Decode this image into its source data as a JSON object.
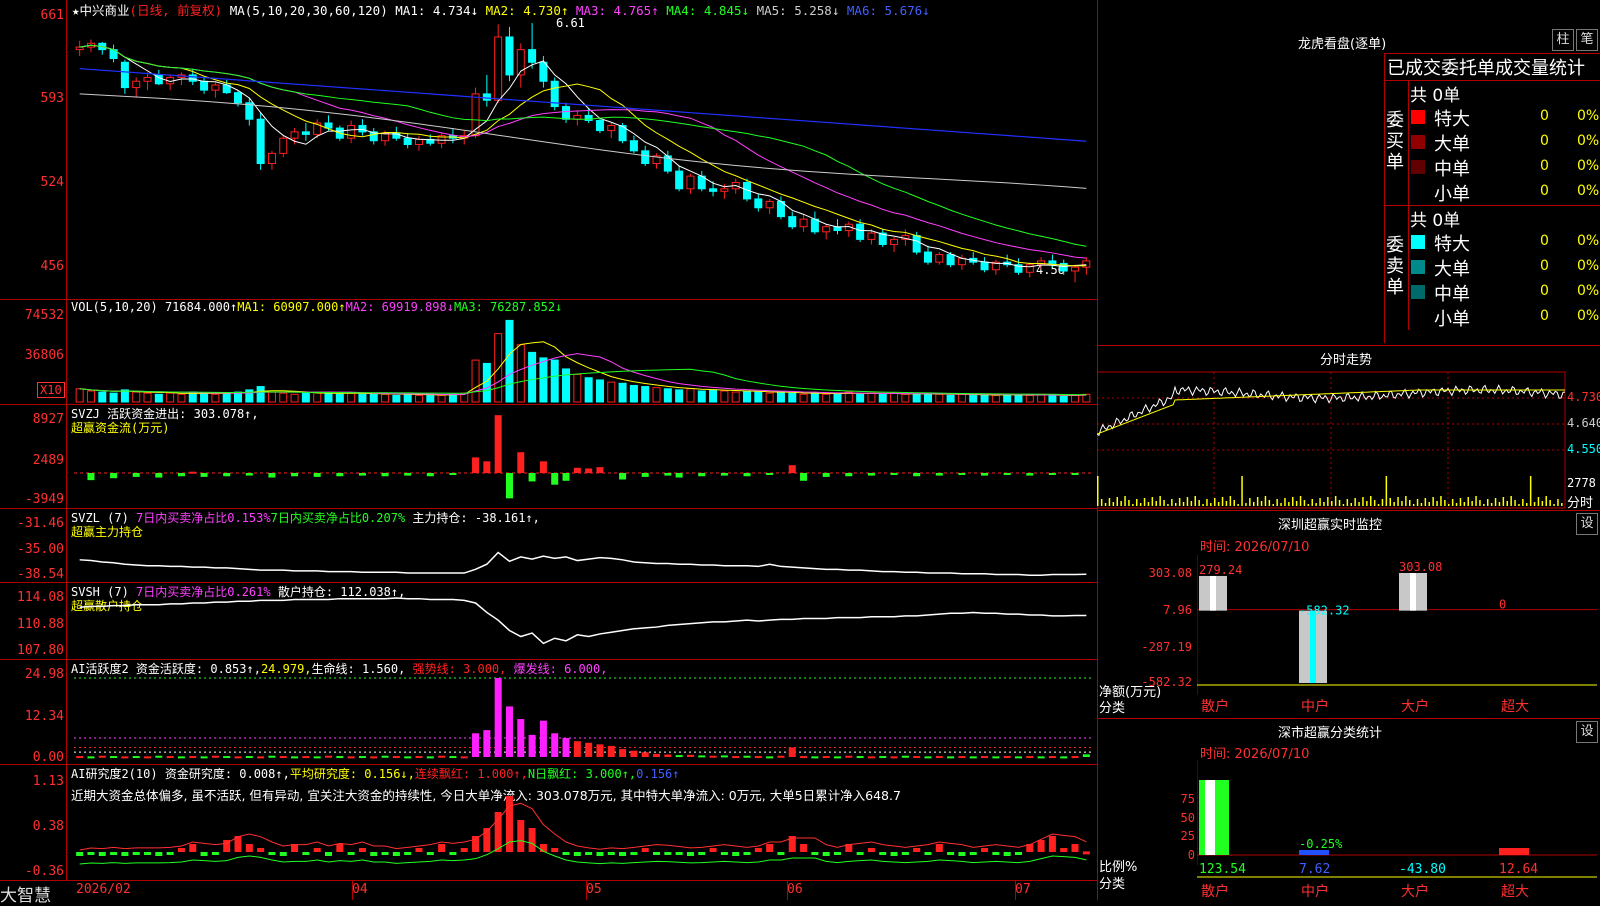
{
  "colors": {
    "up": "#ff2020",
    "down": "#00ffff",
    "bg": "#000000",
    "ma1": "#ffffff",
    "ma2": "#ffff00",
    "ma3": "#ff40ff",
    "ma4": "#20ff20",
    "ma5": "#cccccc",
    "ma6": "#2030ff"
  },
  "main": {
    "star": "★",
    "name": "中兴商业",
    "mode": "(日线, 前复权)",
    "ma_title": "MA(5,10,20,30,60,120)",
    "ma1": "MA1: 4.734↓",
    "ma2": "MA2: 4.730↑",
    "ma3": "MA3: 4.765↑",
    "ma4": "MA4: 4.845↓",
    "ma5": "MA5: 5.258↓",
    "ma6": "MA6: 5.676↓",
    "high_mark": "6.61",
    "low_mark": "4.56",
    "y_ticks": [
      "661",
      "593",
      "524",
      "456"
    ]
  },
  "vol": {
    "title": "VOL(5,10,20)",
    "value": "71684.000↑",
    "ma1": "MA1: 60907.000↑",
    "ma2": "MA2: 69919.898↓",
    "ma3": "MA3: 76287.852↓",
    "y_ticks": [
      "74532",
      "36806"
    ],
    "unit": "X10"
  },
  "svzj": {
    "title": "SVZJ",
    "label": "活跃资金进出: 303.078↑,",
    "sub": "超赢资金流(万元)",
    "y_ticks": [
      "8927",
      "2489",
      "-3949"
    ]
  },
  "svzl": {
    "title": "SVZL (7)",
    "a": "7日内买卖净占比0.153%",
    "b": "7日内买卖净占比0.207%",
    "c": "主力持仓: -38.161↑,",
    "sub": "超赢主力持仓",
    "y_ticks": [
      "-31.46",
      "-35.00",
      "-38.54"
    ]
  },
  "svsh": {
    "title": "SVSH (7)",
    "a": "7日内买卖净占比0.261%",
    "c": "散户持仓: 112.038↑,",
    "sub": "超赢散户持仓",
    "y_ticks": [
      "114.08",
      "110.88",
      "107.80"
    ]
  },
  "ai1": {
    "title": "AI活跃度2",
    "a": "资金活跃度: 0.853↑,",
    "b": "24.979,",
    "c": "生命线: 1.560,",
    "d": "强势线: 3.000,",
    "e": "爆发线: 6.000,",
    "y_ticks": [
      "24.98",
      "12.34",
      "0.00"
    ]
  },
  "ai2": {
    "title": "AI研究度2(10)",
    "a": "资金研究度: 0.008↑,",
    "b": "平均研究度: 0.156↓,",
    "c": "连续飘红: 1.000↑,",
    "d": "N日飘红: 3.000↑,",
    "e": "0.156↑",
    "comment": "近期大资金总体偏多, 虽不活跃, 但有异动, 宜关注大资金的持续性, 今日大单净流入: 303.078万元, 其中特大单净流入: 0万元, 大单5日累计净入648.7",
    "y_ticks": [
      "1.13",
      "0.38",
      "-0.36"
    ]
  },
  "xaxis": {
    "labels": [
      "2026/02",
      "04",
      "05",
      "06",
      "07"
    ],
    "brand": "大智慧"
  },
  "right": {
    "lhk_title": "龙虎看盘(逐单)",
    "btn1": "柱",
    "btn2": "笔",
    "stat_title": "已成交委托单成交量统计",
    "buy_label": "委买单",
    "sell_label": "委卖单",
    "buy_total": "共 0单",
    "sell_total": "共 0单",
    "buy_rows": [
      {
        "name": "特大",
        "count": "0",
        "pct": "0%",
        "color": "#ff0000"
      },
      {
        "name": "大单",
        "count": "0",
        "pct": "0%",
        "color": "#900000"
      },
      {
        "name": "中单",
        "count": "0",
        "pct": "0%",
        "color": "#600000"
      },
      {
        "name": "小单",
        "count": "0",
        "pct": "0%",
        "color": "#000000"
      }
    ],
    "sell_rows": [
      {
        "name": "特大",
        "count": "0",
        "pct": "0%",
        "color": "#00ffff"
      },
      {
        "name": "大单",
        "count": "0",
        "pct": "0%",
        "color": "#008a8a"
      },
      {
        "name": "中单",
        "count": "0",
        "pct": "0%",
        "color": "#006a6a"
      },
      {
        "name": "小单",
        "count": "0",
        "pct": "0%",
        "color": "#000000"
      }
    ],
    "intraday_title": "分时走势",
    "intraday_ticks": [
      "4.730",
      "4.640",
      "4.550"
    ],
    "intraday_vol": "2778",
    "intraday_vol_unit": "分时",
    "sz_title": "深圳超赢实时监控",
    "sz_btn": "设",
    "sz_time": "时间: 2026/07/10",
    "sz_ticks": [
      "303.08",
      "7.96",
      "-287.19",
      "-582.32"
    ],
    "sz_axis1": "净额(万元)",
    "sz_axis2": "分类",
    "sz_values": [
      {
        "label": "279.24",
        "v": 279.24
      },
      {
        "label": "-582.32",
        "v": -582.32
      },
      {
        "label": "303.08",
        "v": 303.08
      },
      {
        "label": "0",
        "v": 0
      }
    ],
    "sz_cats": [
      "散户",
      "中户",
      "大户",
      "超大"
    ],
    "cls_title": "深市超赢分类统计",
    "cls_btn": "设",
    "cls_time": "时间: 2026/07/10",
    "cls_ticks": [
      "75",
      "50",
      "25",
      "0"
    ],
    "cls_axis1": "比例%",
    "cls_axis2": "分类",
    "cls_values": [
      "123.54",
      "7.62",
      "-43.80",
      "12.64"
    ],
    "cls_mid": "-0.25%",
    "cls_cats": [
      "散户",
      "中户",
      "大户",
      "超大"
    ]
  },
  "chart_data": {
    "type": "candlestick",
    "title": "中兴商业",
    "xlabel": "",
    "ylabel": "",
    "x_labels": [
      "2026/02",
      "04",
      "05",
      "06",
      "07"
    ],
    "ylim": [
      4.5,
      6.65
    ],
    "ohlc": [
      [
        6.4,
        6.47,
        6.35,
        6.42
      ],
      [
        6.42,
        6.48,
        6.38,
        6.45
      ],
      [
        6.45,
        6.46,
        6.36,
        6.4
      ],
      [
        6.4,
        6.44,
        6.3,
        6.33
      ],
      [
        6.3,
        6.32,
        6.05,
        6.1
      ],
      [
        6.1,
        6.18,
        6.02,
        6.15
      ],
      [
        6.15,
        6.22,
        6.08,
        6.18
      ],
      [
        6.2,
        6.24,
        6.12,
        6.13
      ],
      [
        6.13,
        6.2,
        6.08,
        6.18
      ],
      [
        6.18,
        6.22,
        6.12,
        6.2
      ],
      [
        6.2,
        6.25,
        6.12,
        6.15
      ],
      [
        6.15,
        6.19,
        6.05,
        6.08
      ],
      [
        6.08,
        6.14,
        6.02,
        6.12
      ],
      [
        6.12,
        6.16,
        6.05,
        6.06
      ],
      [
        6.06,
        6.08,
        5.95,
        5.98
      ],
      [
        5.98,
        6.02,
        5.8,
        5.85
      ],
      [
        5.85,
        5.9,
        5.45,
        5.5
      ],
      [
        5.5,
        5.6,
        5.45,
        5.58
      ],
      [
        5.58,
        5.72,
        5.55,
        5.7
      ],
      [
        5.7,
        5.78,
        5.65,
        5.75
      ],
      [
        5.75,
        5.82,
        5.68,
        5.73
      ],
      [
        5.73,
        5.85,
        5.7,
        5.82
      ],
      [
        5.82,
        5.88,
        5.76,
        5.78
      ],
      [
        5.78,
        5.8,
        5.68,
        5.7
      ],
      [
        5.7,
        5.84,
        5.66,
        5.8
      ],
      [
        5.8,
        5.85,
        5.72,
        5.75
      ],
      [
        5.75,
        5.78,
        5.65,
        5.68
      ],
      [
        5.68,
        5.76,
        5.64,
        5.74
      ],
      [
        5.74,
        5.79,
        5.68,
        5.7
      ],
      [
        5.7,
        5.74,
        5.62,
        5.65
      ],
      [
        5.65,
        5.72,
        5.6,
        5.69
      ],
      [
        5.69,
        5.73,
        5.64,
        5.66
      ],
      [
        5.66,
        5.74,
        5.62,
        5.72
      ],
      [
        5.72,
        5.78,
        5.66,
        5.7
      ],
      [
        5.7,
        5.76,
        5.65,
        5.72
      ],
      [
        5.72,
        6.1,
        5.7,
        6.05
      ],
      [
        6.05,
        6.2,
        5.95,
        6.0
      ],
      [
        6.0,
        6.6,
        5.98,
        6.5
      ],
      [
        6.5,
        6.58,
        6.15,
        6.2
      ],
      [
        6.2,
        6.45,
        6.1,
        6.4
      ],
      [
        6.4,
        6.61,
        6.25,
        6.3
      ],
      [
        6.3,
        6.35,
        6.1,
        6.15
      ],
      [
        6.15,
        6.18,
        5.92,
        5.95
      ],
      [
        5.95,
        5.98,
        5.82,
        5.85
      ],
      [
        5.85,
        5.92,
        5.8,
        5.88
      ],
      [
        5.88,
        5.94,
        5.82,
        5.84
      ],
      [
        5.84,
        5.86,
        5.74,
        5.76
      ],
      [
        5.76,
        5.82,
        5.7,
        5.8
      ],
      [
        5.8,
        5.82,
        5.66,
        5.68
      ],
      [
        5.68,
        5.72,
        5.58,
        5.6
      ],
      [
        5.6,
        5.64,
        5.48,
        5.5
      ],
      [
        5.5,
        5.58,
        5.46,
        5.56
      ],
      [
        5.56,
        5.6,
        5.42,
        5.44
      ],
      [
        5.44,
        5.48,
        5.28,
        5.3
      ],
      [
        5.3,
        5.42,
        5.26,
        5.4
      ],
      [
        5.4,
        5.44,
        5.28,
        5.3
      ],
      [
        5.3,
        5.36,
        5.24,
        5.28
      ],
      [
        5.28,
        5.34,
        5.22,
        5.3
      ],
      [
        5.3,
        5.38,
        5.26,
        5.35
      ],
      [
        5.35,
        5.38,
        5.2,
        5.22
      ],
      [
        5.22,
        5.26,
        5.12,
        5.15
      ],
      [
        5.15,
        5.22,
        5.1,
        5.2
      ],
      [
        5.2,
        5.24,
        5.06,
        5.08
      ],
      [
        5.08,
        5.12,
        4.98,
        5.0
      ],
      [
        5.0,
        5.1,
        4.96,
        5.06
      ],
      [
        5.06,
        5.12,
        4.94,
        4.96
      ],
      [
        4.96,
        5.02,
        4.9,
        5.0
      ],
      [
        5.0,
        5.06,
        4.94,
        4.97
      ],
      [
        4.97,
        5.04,
        4.92,
        5.02
      ],
      [
        5.02,
        5.06,
        4.88,
        4.9
      ],
      [
        4.9,
        4.98,
        4.86,
        4.95
      ],
      [
        4.95,
        4.98,
        4.84,
        4.86
      ],
      [
        4.86,
        4.92,
        4.8,
        4.9
      ],
      [
        4.9,
        4.98,
        4.85,
        4.93
      ],
      [
        4.93,
        4.96,
        4.78,
        4.8
      ],
      [
        4.8,
        4.85,
        4.7,
        4.72
      ],
      [
        4.72,
        4.8,
        4.7,
        4.78
      ],
      [
        4.78,
        4.8,
        4.68,
        4.7
      ],
      [
        4.7,
        4.78,
        4.66,
        4.75
      ],
      [
        4.75,
        4.8,
        4.7,
        4.72
      ],
      [
        4.72,
        4.76,
        4.64,
        4.66
      ],
      [
        4.66,
        4.74,
        4.62,
        4.72
      ],
      [
        4.72,
        4.78,
        4.68,
        4.7
      ],
      [
        4.7,
        4.75,
        4.62,
        4.64
      ],
      [
        4.64,
        4.72,
        4.6,
        4.7
      ],
      [
        4.7,
        4.76,
        4.66,
        4.73
      ],
      [
        4.73,
        4.78,
        4.68,
        4.71
      ],
      [
        4.71,
        4.74,
        4.62,
        4.65
      ],
      [
        4.65,
        4.7,
        4.56,
        4.68
      ],
      [
        4.68,
        4.76,
        4.62,
        4.73
      ]
    ],
    "volume": [
      12,
      10,
      9,
      8,
      11,
      9,
      8,
      7,
      8,
      7,
      9,
      8,
      7,
      8,
      9,
      11,
      14,
      9,
      8,
      7,
      8,
      9,
      8,
      7,
      8,
      7,
      8,
      7,
      6,
      7,
      6,
      7,
      6,
      7,
      8,
      38,
      35,
      62,
      74,
      52,
      45,
      40,
      38,
      30,
      25,
      22,
      20,
      18,
      17,
      15,
      14,
      13,
      12,
      11,
      12,
      10,
      11,
      10,
      9,
      10,
      9,
      8,
      9,
      8,
      7,
      8,
      7,
      8,
      9,
      7,
      8,
      7,
      8,
      7,
      7,
      8,
      7,
      6,
      7,
      6,
      7,
      6,
      7,
      6,
      6,
      7,
      6,
      5,
      6,
      7
    ],
    "svzj": [
      0,
      -1.1,
      0,
      -0.8,
      0,
      -0.6,
      0,
      -0.7,
      0,
      -0.5,
      0.2,
      -0.6,
      0,
      -0.5,
      0,
      -0.4,
      0,
      -0.7,
      0,
      -0.5,
      0,
      -0.6,
      0,
      -0.5,
      0,
      -0.4,
      0,
      -0.5,
      0,
      -0.4,
      0,
      -0.5,
      0,
      -0.3,
      0,
      2.4,
      1.8,
      8.9,
      -3.9,
      3.2,
      -1.3,
      1.8,
      -1.8,
      -1.2,
      0.8,
      0.7,
      0.9,
      0,
      -1.0,
      0,
      -0.6,
      0,
      -0.4,
      -0.7,
      0,
      -0.5,
      0,
      -0.4,
      0,
      -0.5,
      0,
      -0.3,
      0,
      1.2,
      -1.2,
      0,
      -0.6,
      0,
      -0.5,
      0,
      -0.4,
      0,
      -0.3,
      0,
      -0.5,
      0,
      -0.4,
      0,
      -0.3,
      0,
      -0.4,
      0,
      -0.3,
      0,
      -0.4,
      0,
      -0.3,
      0,
      -0.3,
      0
    ],
    "svzl": [
      -36.2,
      -36.3,
      -36.5,
      -36.6,
      -36.8,
      -36.9,
      -37.0,
      -37.0,
      -37.1,
      -37.1,
      -37.2,
      -37.2,
      -37.3,
      -37.3,
      -37.4,
      -37.5,
      -37.6,
      -37.6,
      -37.6,
      -37.7,
      -37.7,
      -37.7,
      -37.8,
      -37.8,
      -37.8,
      -37.9,
      -37.9,
      -37.9,
      -37.9,
      -38.0,
      -38.0,
      -38.0,
      -38.0,
      -38.0,
      -38.0,
      -37.5,
      -36.8,
      -35.2,
      -36.4,
      -35.8,
      -36.1,
      -35.7,
      -36.0,
      -35.8,
      -36.3,
      -36.1,
      -35.9,
      -36.0,
      -36.2,
      -36.5,
      -36.6,
      -36.7,
      -36.7,
      -36.8,
      -36.8,
      -36.9,
      -36.9,
      -37.0,
      -37.0,
      -37.0,
      -37.1,
      -36.8,
      -37.1,
      -37.2,
      -37.3,
      -37.4,
      -37.5,
      -37.5,
      -37.6,
      -37.6,
      -37.7,
      -37.8,
      -37.8,
      -37.9,
      -37.9,
      -38.0,
      -38.0,
      -38.0,
      -38.1,
      -38.1,
      -38.1,
      -38.2,
      -38.2,
      -38.2,
      -38.3,
      -38.3,
      -38.2,
      -38.2,
      -38.2,
      -38.16
    ],
    "svsh": [
      113.0,
      113.1,
      113.1,
      113.2,
      113.2,
      113.3,
      113.3,
      113.3,
      113.4,
      113.4,
      113.5,
      113.5,
      113.6,
      113.6,
      113.7,
      113.7,
      113.8,
      113.8,
      113.8,
      113.9,
      113.9,
      113.9,
      113.9,
      114.0,
      114.0,
      114.0,
      114.0,
      114.0,
      114.08,
      114.0,
      114.0,
      113.9,
      113.9,
      113.9,
      113.8,
      113.5,
      112.4,
      111.5,
      110.3,
      109.6,
      110.0,
      108.8,
      109.4,
      109.1,
      109.8,
      109.6,
      109.9,
      110.1,
      110.3,
      110.5,
      110.6,
      110.7,
      110.9,
      111.0,
      111.1,
      111.2,
      111.3,
      111.3,
      111.4,
      111.5,
      111.4,
      111.5,
      111.6,
      111.6,
      111.7,
      111.7,
      111.7,
      111.8,
      111.8,
      111.8,
      111.9,
      111.9,
      111.9,
      112.0,
      112.0,
      112.1,
      112.2,
      112.3,
      112.3,
      112.4,
      112.3,
      112.3,
      112.2,
      112.2,
      112.1,
      112.1,
      112.0,
      112.0,
      112.04,
      112.04
    ],
    "ai1": [
      0.3,
      0.2,
      0.4,
      0.3,
      0.2,
      0.3,
      0.2,
      0.4,
      0.3,
      0.2,
      0.3,
      0.2,
      0.4,
      0.3,
      0.2,
      0.3,
      0.2,
      0.4,
      0.3,
      0.2,
      0.3,
      0.2,
      0.4,
      0.3,
      0.2,
      0.3,
      0.2,
      0.4,
      0.3,
      0.2,
      0.3,
      0.2,
      0.4,
      0.3,
      0.2,
      7.5,
      8.5,
      24.98,
      16.0,
      12.0,
      7.0,
      11.5,
      7.5,
      6.0,
      5.0,
      4.5,
      4.0,
      3.5,
      2.5,
      2.0,
      1.5,
      1.0,
      0.8,
      0.6,
      0.7,
      0.5,
      0.4,
      0.5,
      0.3,
      0.4,
      0.3,
      0.2,
      0.4,
      3.0,
      0.3,
      0.2,
      0.3,
      0.2,
      0.4,
      0.3,
      0.2,
      0.3,
      0.2,
      0.4,
      0.3,
      0.2,
      0.3,
      0.2,
      0.3,
      0.2,
      0.3,
      0.2,
      0.3,
      0.2,
      0.3,
      0.2,
      0.3,
      0.2,
      0.3,
      0.85
    ],
    "ai2": [
      -0.05,
      0,
      -0.05,
      0,
      -0.05,
      -0.02,
      0,
      -0.05,
      0,
      0.05,
      0.1,
      -0.05,
      0,
      0.15,
      0.2,
      0.1,
      0.05,
      0,
      -0.05,
      0.1,
      0,
      0.05,
      -0.05,
      0.1,
      0,
      0.05,
      -0.05,
      0,
      -0.05,
      0,
      0.05,
      0,
      0.1,
      0,
      0.05,
      0.2,
      0.3,
      0.5,
      0.7,
      0.4,
      0.3,
      0.1,
      0.05,
      0,
      -0.05,
      -0.02,
      -0.05,
      0,
      -0.05,
      0,
      0.05,
      0,
      -0.02,
      0,
      -0.05,
      0,
      0.05,
      0,
      -0.05,
      0,
      0.05,
      0.1,
      0,
      0.2,
      0.1,
      0,
      -0.05,
      0,
      0.1,
      0,
      0.05,
      0,
      -0.05,
      0,
      0.05,
      0,
      0.1,
      0,
      -0.05,
      0,
      0.05,
      0,
      -0.05,
      0,
      0.1,
      0.15,
      0.2,
      0.05,
      0.1,
      0.008
    ]
  }
}
